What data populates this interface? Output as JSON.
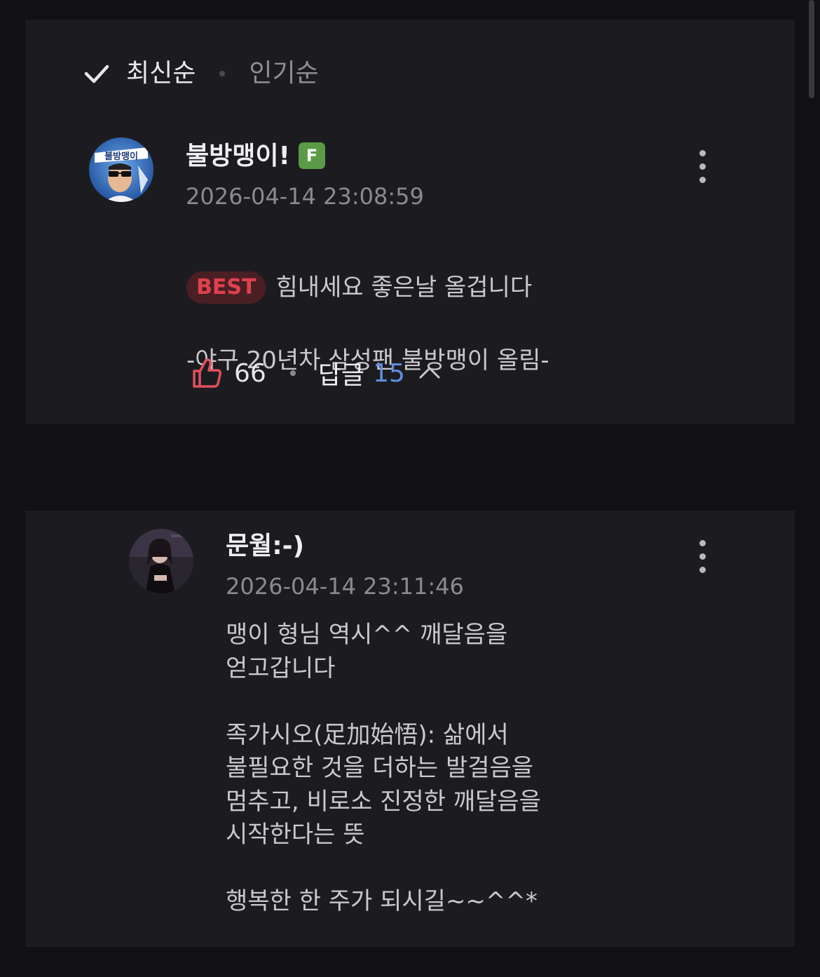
{
  "sort": {
    "options": [
      "최신순",
      "인기순"
    ],
    "selected": "최신순"
  },
  "comments": [
    {
      "username": "불방맹이!",
      "badge": "F",
      "timestamp": "2026-04-14 23:08:59",
      "best_label": "BEST",
      "text_line1": "힘내세요 좋은날 올겁니다",
      "text_line2": "-야구 20년차 삼성팬 불방맹이 올림-",
      "avatar_text": "불방맹이",
      "likes": "66",
      "reply_label": "답글",
      "reply_count": "15"
    },
    {
      "username": "문월:-)",
      "timestamp": "2026-04-14 23:11:46",
      "text": "맹이 형님 역시^^ 깨달음을\n얻고갑니다\n\n족가시오(足加始悟): 삶에서\n불필요한 것을 더하는 발걸음을\n멈추고, 비로소 진정한 깨달음을\n시작한다는 뜻\n\n행복한 한 주가 되시길~~^^*"
    }
  ],
  "colors": {
    "background": "#111113",
    "card": "#1c1c20",
    "best": "#e0404d",
    "reply_count": "#5e8fe0",
    "like_icon": "#e0505c",
    "badge_f": "#5b9a46"
  },
  "icons": [
    "check-icon",
    "more-vertical-icon",
    "thumbs-up-icon",
    "chevron-up-icon"
  ]
}
